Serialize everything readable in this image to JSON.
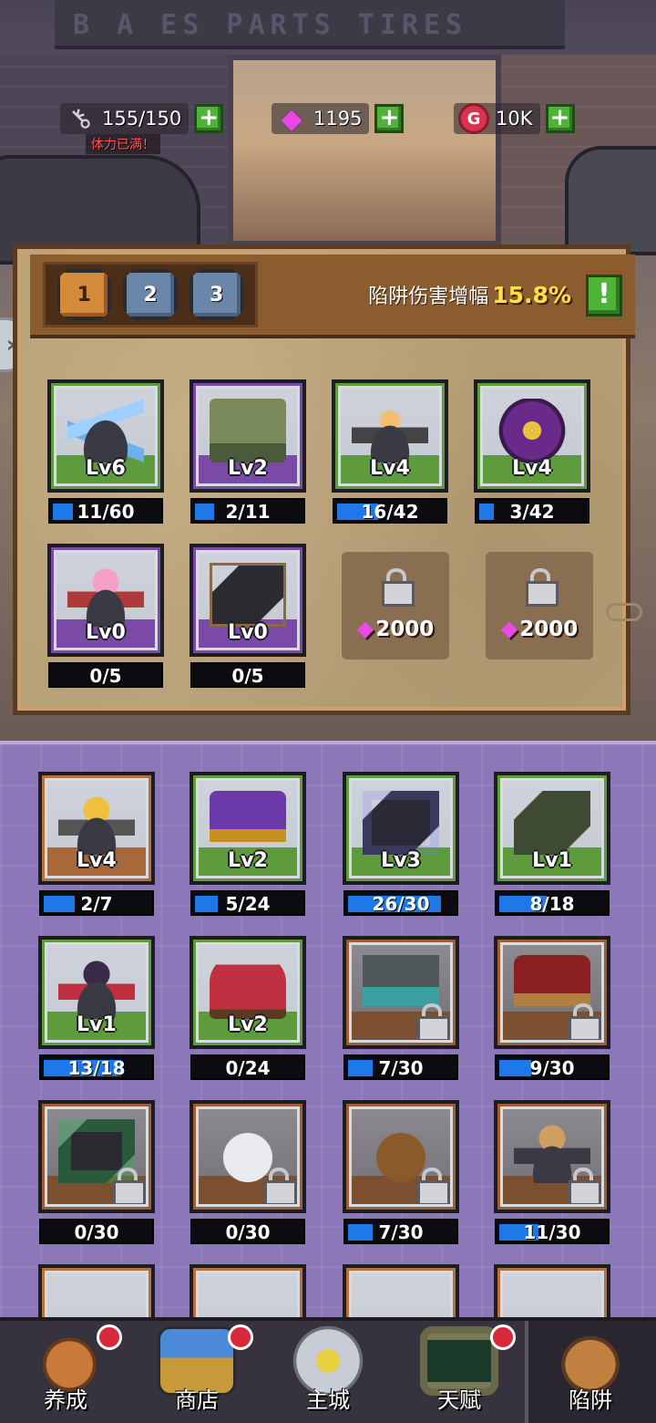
{
  "resources": {
    "stamina": {
      "value": "155/150",
      "status": "体力已满！",
      "icon": "key-icon"
    },
    "gems": {
      "value": "1195",
      "icon": "gem-icon"
    },
    "gold": {
      "value": "10K",
      "icon": "gold-icon",
      "symbol": "G"
    },
    "add_symbol": "+"
  },
  "panel": {
    "tabs": [
      {
        "label": "1",
        "active": true
      },
      {
        "label": "2",
        "active": false
      },
      {
        "label": "3",
        "active": false
      }
    ],
    "bonus_label": "陷阱伤害增幅",
    "bonus_value": "15.8%",
    "info_symbol": "!",
    "side_arrow": "»",
    "equipped": [
      {
        "name": "ice-spike-trap",
        "level": "Lv6",
        "progress": "11/60",
        "fraction": 0.183,
        "rarity": "green"
      },
      {
        "name": "stone-gate-trap",
        "level": "Lv2",
        "progress": "2/11",
        "fraction": 0.182,
        "rarity": "purple"
      },
      {
        "name": "blonde-turret-trap",
        "level": "Lv4",
        "progress": "16/42",
        "fraction": 0.381,
        "rarity": "green"
      },
      {
        "name": "rune-circle-trap",
        "level": "Lv4",
        "progress": "3/42",
        "fraction": 0.071,
        "rarity": "green"
      },
      {
        "name": "pink-hair-trap",
        "level": "Lv0",
        "progress": "0/5",
        "fraction": 0,
        "rarity": "purple"
      },
      {
        "name": "dark-plate-trap",
        "level": "Lv0",
        "progress": "0/5",
        "fraction": 0,
        "rarity": "purple"
      }
    ],
    "locked_slots": [
      {
        "cost": "2000"
      },
      {
        "cost": "2000"
      }
    ]
  },
  "collection": [
    {
      "name": "goggles-girl-trap",
      "level": "Lv4",
      "progress": "2/7",
      "fraction": 0.286,
      "rarity": "orange",
      "locked": false
    },
    {
      "name": "furnace-trap",
      "level": "Lv2",
      "progress": "5/24",
      "fraction": 0.208,
      "rarity": "green",
      "locked": false
    },
    {
      "name": "portal-pad-trap",
      "level": "Lv3",
      "progress": "26/30",
      "fraction": 0.867,
      "rarity": "green",
      "locked": false
    },
    {
      "name": "mossy-vent-trap",
      "level": "Lv1",
      "progress": "8/18",
      "fraction": 0.444,
      "rarity": "green",
      "locked": false
    },
    {
      "name": "red-ninja-trap",
      "level": "Lv1",
      "progress": "13/18",
      "fraction": 0.722,
      "rarity": "green",
      "locked": false
    },
    {
      "name": "red-cannon-trap",
      "level": "Lv2",
      "progress": "0/24",
      "fraction": 0,
      "rarity": "green",
      "locked": false
    },
    {
      "name": "water-gate-trap",
      "level": "",
      "progress": "7/30",
      "fraction": 0.233,
      "rarity": "orange-locked",
      "locked": true
    },
    {
      "name": "flame-launcher-trap",
      "level": "",
      "progress": "9/30",
      "fraction": 0.3,
      "rarity": "orange-locked",
      "locked": true
    },
    {
      "name": "green-plate-trap",
      "level": "",
      "progress": "0/30",
      "fraction": 0,
      "rarity": "orange-locked",
      "locked": true
    },
    {
      "name": "crystal-dome-trap",
      "level": "",
      "progress": "0/30",
      "fraction": 0,
      "rarity": "orange-locked",
      "locked": true
    },
    {
      "name": "bomb-dome-trap",
      "level": "",
      "progress": "7/30",
      "fraction": 0.233,
      "rarity": "orange-locked",
      "locked": true
    },
    {
      "name": "gold-robot-trap",
      "level": "",
      "progress": "11/30",
      "fraction": 0.367,
      "rarity": "orange-locked",
      "locked": true
    }
  ],
  "nav": [
    {
      "label": "养成",
      "icon": "muscle-arm-icon",
      "badge": true,
      "active": false
    },
    {
      "label": "商店",
      "icon": "treasure-chest-icon",
      "badge": true,
      "active": false
    },
    {
      "label": "主城",
      "icon": "city-emblem-icon",
      "badge": false,
      "active": false
    },
    {
      "label": "天赋",
      "icon": "talent-screen-icon",
      "badge": true,
      "active": false
    },
    {
      "label": "陷阱",
      "icon": "trap-machine-icon",
      "badge": false,
      "active": true
    }
  ],
  "colors": {
    "progress_fill": "#1e78e8",
    "gem": "#e848e8",
    "bonus_value": "#ffe040",
    "add_button": "#4fb33a",
    "badge": "#d8283a"
  }
}
